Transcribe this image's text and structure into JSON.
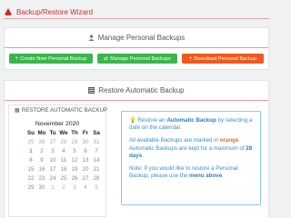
{
  "window": {
    "title": "Backup/Restore Wizard",
    "accent": "#c8302c"
  },
  "manual": {
    "heading": "Manage Personal Backups",
    "buttons": [
      {
        "label": "Create New Personal Backup",
        "icon": "plus-icon",
        "color": "#3bb54a"
      },
      {
        "label": "Manage Personal Backups",
        "icon": "arrows-icon",
        "color": "#3bb54a"
      },
      {
        "label": "Download Personal Backup",
        "icon": "plus-icon",
        "color": "#ef5a1c"
      }
    ]
  },
  "automatic": {
    "heading": "Restore Automatic Backup",
    "calendar_title": "RESTORE AUTOMATIC BACKUP",
    "month": "November 2020",
    "weekdays": [
      "Su",
      "Mo",
      "Tu",
      "We",
      "Th",
      "Fr",
      "Sa"
    ],
    "weeks": [
      [
        {
          "d": "25",
          "t": "other"
        },
        {
          "d": "26",
          "t": "other"
        },
        {
          "d": "27",
          "t": "other"
        },
        {
          "d": "28",
          "t": "other"
        },
        {
          "d": "29",
          "t": "other"
        },
        {
          "d": "30",
          "t": "other"
        },
        {
          "d": "31",
          "t": "other"
        }
      ],
      [
        {
          "d": "1",
          "t": "today"
        },
        {
          "d": "2",
          "t": "cur"
        },
        {
          "d": "3",
          "t": "cur"
        },
        {
          "d": "4",
          "t": "cur"
        },
        {
          "d": "5",
          "t": "cur"
        },
        {
          "d": "6",
          "t": "cur"
        },
        {
          "d": "7",
          "t": "cur"
        }
      ],
      [
        {
          "d": "8",
          "t": "cur"
        },
        {
          "d": "9",
          "t": "cur"
        },
        {
          "d": "10",
          "t": "cur"
        },
        {
          "d": "11",
          "t": "cur"
        },
        {
          "d": "12",
          "t": "cur"
        },
        {
          "d": "13",
          "t": "cur"
        },
        {
          "d": "14",
          "t": "cur"
        }
      ],
      [
        {
          "d": "15",
          "t": "cur"
        },
        {
          "d": "16",
          "t": "cur"
        },
        {
          "d": "17",
          "t": "cur"
        },
        {
          "d": "18",
          "t": "cur"
        },
        {
          "d": "19",
          "t": "cur"
        },
        {
          "d": "20",
          "t": "cur"
        },
        {
          "d": "21",
          "t": "cur"
        }
      ],
      [
        {
          "d": "22",
          "t": "cur"
        },
        {
          "d": "23",
          "t": "cur"
        },
        {
          "d": "24",
          "t": "cur"
        },
        {
          "d": "25",
          "t": "cur"
        },
        {
          "d": "26",
          "t": "cur"
        },
        {
          "d": "27",
          "t": "cur"
        },
        {
          "d": "28",
          "t": "cur"
        }
      ],
      [
        {
          "d": "29",
          "t": "cur"
        },
        {
          "d": "30",
          "t": "cur"
        },
        {
          "d": "1",
          "t": "other"
        },
        {
          "d": "2",
          "t": "other"
        },
        {
          "d": "3",
          "t": "other"
        },
        {
          "d": "4",
          "t": "other"
        },
        {
          "d": "5",
          "t": "other"
        }
      ]
    ],
    "info": {
      "p1_pre": "Restore an ",
      "p1_bold": "Automatic Backup",
      "p1_post": " by selecting a date on the calendar.",
      "p2_pre": "All available Backups are marked in ",
      "p2_bold1": "orange",
      "p2_mid": ". Automatic Backups are kept for a maximum of ",
      "p2_bold2": "28 days",
      "p2_post": ".",
      "p3_pre": "Note: If you would like to restore a Personal Backup, please use the ",
      "p3_bold": "menu above",
      "p3_post": "."
    }
  }
}
